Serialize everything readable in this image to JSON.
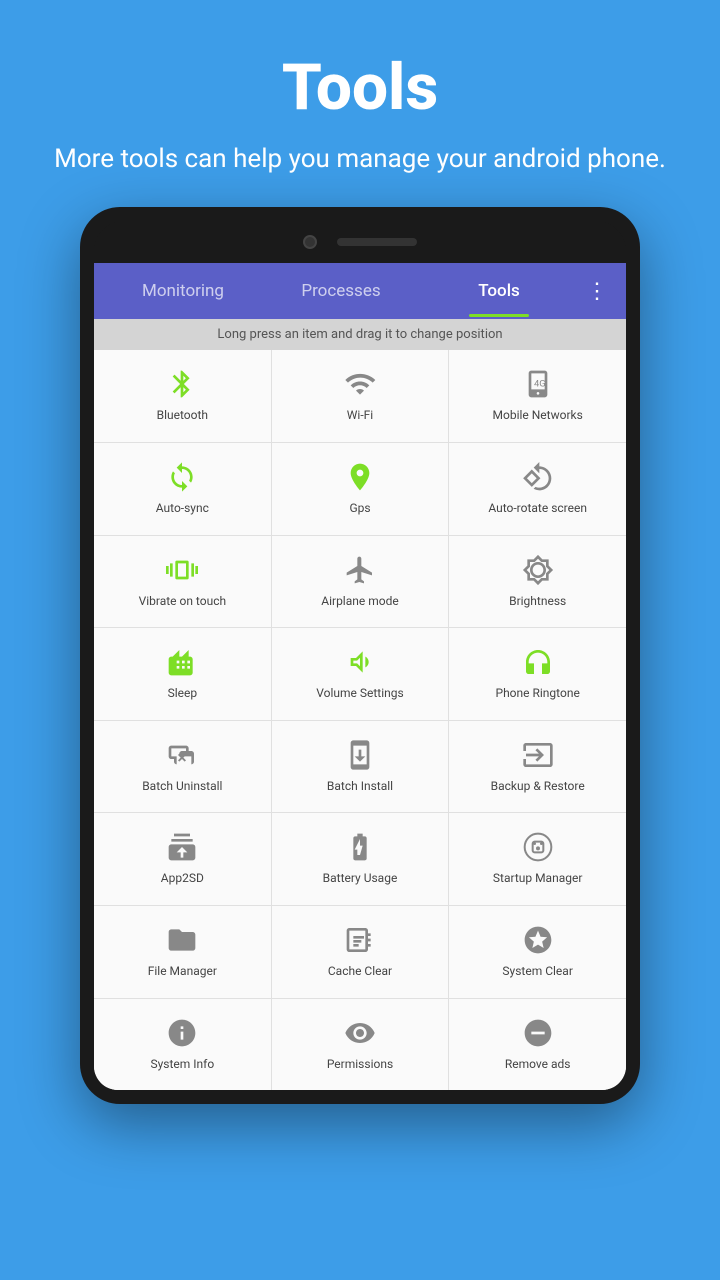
{
  "header": {
    "title": "Tools",
    "subtitle": "More tools can help you manage your android phone."
  },
  "tabs": [
    {
      "label": "Monitoring",
      "active": false
    },
    {
      "label": "Processes",
      "active": false
    },
    {
      "label": "Tools",
      "active": true
    }
  ],
  "menu_icon": "⋮",
  "hint": "Long press an item and drag it to change position",
  "tools": [
    {
      "label": "Bluetooth",
      "icon": "bluetooth",
      "color": "green"
    },
    {
      "label": "Wi-Fi",
      "icon": "wifi",
      "color": "gray"
    },
    {
      "label": "Mobile Networks",
      "icon": "mobile-network",
      "color": "gray"
    },
    {
      "label": "Auto-sync",
      "icon": "sync",
      "color": "green"
    },
    {
      "label": "Gps",
      "icon": "gps",
      "color": "green"
    },
    {
      "label": "Auto-rotate screen",
      "icon": "rotate",
      "color": "gray"
    },
    {
      "label": "Vibrate on touch",
      "icon": "vibrate",
      "color": "green"
    },
    {
      "label": "Airplane mode",
      "icon": "airplane",
      "color": "gray"
    },
    {
      "label": "Brightness",
      "icon": "brightness",
      "color": "gray"
    },
    {
      "label": "Sleep",
      "icon": "sleep",
      "color": "green"
    },
    {
      "label": "Volume Settings",
      "icon": "volume",
      "color": "green"
    },
    {
      "label": "Phone Ringtone",
      "icon": "ringtone",
      "color": "green"
    },
    {
      "label": "Batch Uninstall",
      "icon": "batch-uninstall",
      "color": "gray"
    },
    {
      "label": "Batch Install",
      "icon": "batch-install",
      "color": "gray"
    },
    {
      "label": "Backup & Restore",
      "icon": "backup",
      "color": "gray"
    },
    {
      "label": "App2SD",
      "icon": "app2sd",
      "color": "gray"
    },
    {
      "label": "Battery Usage",
      "icon": "battery",
      "color": "gray"
    },
    {
      "label": "Startup Manager",
      "icon": "startup",
      "color": "gray"
    },
    {
      "label": "File Manager",
      "icon": "file",
      "color": "gray"
    },
    {
      "label": "Cache Clear",
      "icon": "cache",
      "color": "gray"
    },
    {
      "label": "System Clear",
      "icon": "system-clear",
      "color": "gray"
    },
    {
      "label": "System Info",
      "icon": "system-info",
      "color": "gray"
    },
    {
      "label": "Permissions",
      "icon": "permissions",
      "color": "gray"
    },
    {
      "label": "Remove ads",
      "icon": "remove-ads",
      "color": "gray"
    }
  ]
}
